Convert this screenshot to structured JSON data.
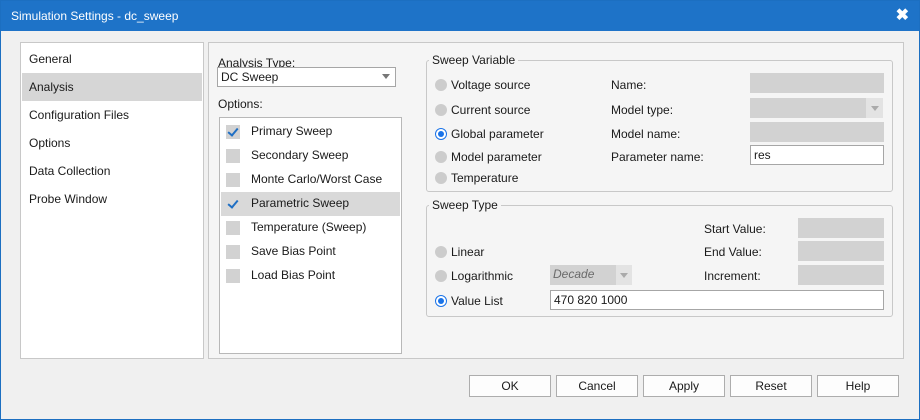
{
  "window": {
    "title": "Simulation Settings - dc_sweep",
    "close_glyph": "✖"
  },
  "sidebar": {
    "items": [
      {
        "label": "General",
        "selected": false
      },
      {
        "label": "Analysis",
        "selected": true
      },
      {
        "label": "Configuration Files",
        "selected": false
      },
      {
        "label": "Options",
        "selected": false
      },
      {
        "label": "Data Collection",
        "selected": false
      },
      {
        "label": "Probe Window",
        "selected": false
      }
    ]
  },
  "analysis": {
    "type_label": "Analysis Type:",
    "type_value": "DC Sweep",
    "options_label": "Options:",
    "options": [
      {
        "label": "Primary Sweep",
        "checked": true,
        "selected": false
      },
      {
        "label": "Secondary Sweep",
        "checked": false,
        "selected": false
      },
      {
        "label": "Monte Carlo/Worst Case",
        "checked": false,
        "selected": false
      },
      {
        "label": "Parametric Sweep",
        "checked": true,
        "selected": true
      },
      {
        "label": "Temperature (Sweep)",
        "checked": false,
        "selected": false
      },
      {
        "label": "Save Bias Point",
        "checked": false,
        "selected": false
      },
      {
        "label": "Load Bias Point",
        "checked": false,
        "selected": false
      }
    ]
  },
  "sweep_variable": {
    "title": "Sweep Variable",
    "radios": [
      {
        "label": "Voltage source",
        "selected": false
      },
      {
        "label": "Current source",
        "selected": false
      },
      {
        "label": "Global parameter",
        "selected": true
      },
      {
        "label": "Model parameter",
        "selected": false
      },
      {
        "label": "Temperature",
        "selected": false
      }
    ],
    "fields": {
      "name_label": "Name:",
      "model_type_label": "Model type:",
      "model_name_label": "Model name:",
      "parameter_name_label": "Parameter name:",
      "parameter_name_value": "res"
    }
  },
  "sweep_type": {
    "title": "Sweep Type",
    "radios": [
      {
        "label": "Linear",
        "selected": false
      },
      {
        "label": "Logarithmic",
        "selected": false
      },
      {
        "label": "Value List",
        "selected": true
      }
    ],
    "log_scale_value": "Decade",
    "start_label": "Start Value:",
    "end_label": "End Value:",
    "increment_label": "Increment:",
    "value_list": "470 820 1000"
  },
  "buttons": {
    "ok": "OK",
    "cancel": "Cancel",
    "apply": "Apply",
    "reset": "Reset",
    "help": "Help"
  },
  "colors": {
    "titlebar": "#1e73c8",
    "radio_selected": "#1a73e8",
    "check": "#1f6fc4"
  }
}
